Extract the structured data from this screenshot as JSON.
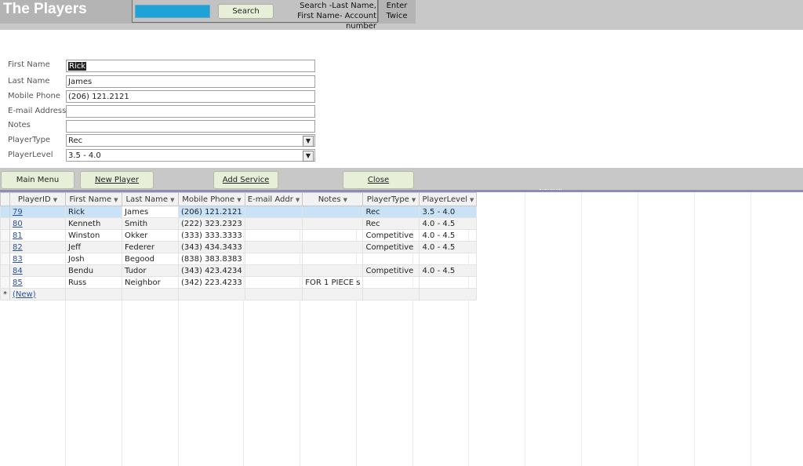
{
  "header": {
    "title": "The Players",
    "search_label": "Search",
    "search_hint_line1": "Search -Last Name,",
    "search_hint_line2": "First Name- Account number",
    "enter_hint_line1": "Enter",
    "enter_hint_line2": "Twice",
    "accent": "#1fa2d6"
  },
  "form": {
    "labels": {
      "first_name": "First Name",
      "last_name": "Last Name",
      "mobile_phone": "Mobile Phone",
      "email": "E-mail Address",
      "notes": "Notes",
      "player_type": "PlayerType",
      "player_level": "PlayerLevel"
    },
    "values": {
      "first_name": "Rick",
      "last_name": "James",
      "mobile_phone": "(206) 121.2121",
      "email": "",
      "notes": "",
      "player_type": "Rec",
      "player_level": "3.5 - 4.0"
    }
  },
  "buttons": {
    "main_menu": "Main Menu",
    "new_player": "New Player",
    "add_service": "Add Service",
    "close": "Close"
  },
  "datasheet": {
    "columns": [
      "PlayerID",
      "First Name",
      "Last Name",
      "Mobile Phone",
      "E-mail Addr",
      "Notes",
      "PlayerType",
      "PlayerLevel"
    ],
    "rows": [
      [
        "79",
        "Rick",
        "James",
        "(206) 121.2121",
        "",
        "",
        "Rec",
        "3.5 - 4.0"
      ],
      [
        "80",
        "Kenneth",
        "Smith",
        "(222) 323.2323",
        "",
        "",
        "Rec",
        "4.0 - 4.5"
      ],
      [
        "81",
        "Winston",
        "Okker",
        "(333) 333.3333",
        "",
        "",
        "Competitive",
        "4.0 - 4.5"
      ],
      [
        "82",
        "Jeff",
        "Federer",
        "(343) 434.3433",
        "",
        "",
        "Competitive",
        "4.0 - 4.5"
      ],
      [
        "83",
        "Josh",
        "Begood",
        "(838) 383.8383",
        "",
        "",
        "",
        ""
      ],
      [
        "84",
        "Bendu",
        "Tudor",
        "(343) 423.4234",
        "",
        "",
        "Competitive",
        "4.0 - 4.5"
      ],
      [
        "85",
        "Russ",
        "Neighbor",
        "(342) 223.4233",
        "",
        "FOR 1 PIECE s",
        "",
        ""
      ]
    ],
    "new_row_label": "(New)",
    "new_row_marker": "*"
  }
}
